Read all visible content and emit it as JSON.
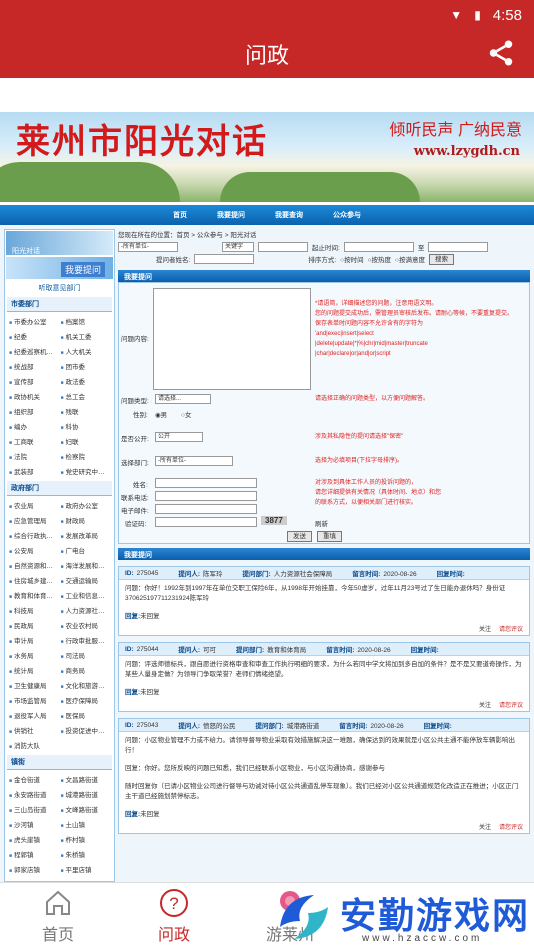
{
  "status": {
    "time": "4:58"
  },
  "appbar": {
    "title": "问政"
  },
  "banner": {
    "title": "莱州市阳光对话",
    "slogan": "倾听民声 广纳民意",
    "url": "www.lzygdh.cn"
  },
  "topnav": [
    "首页",
    "我要提问",
    "我要查询",
    "公众参与"
  ],
  "left": {
    "tile1": "阳光对话",
    "tile2": "我要提问",
    "header": "听取意见部门",
    "sec1": "市委部门",
    "g1": [
      "市委办公室",
      "档案馆",
      "纪委",
      "机关工委",
      "纪委巡察机…",
      "人大机关",
      "统战部",
      "团市委",
      "宣传部",
      "政法委",
      "政协机关",
      "总工会",
      "组织部",
      "残联",
      "编办",
      "科协",
      "工商联",
      "妇联",
      "法院",
      "检察院",
      "武装部",
      "党史研究中…"
    ],
    "sec2": "政府部门",
    "g2": [
      "农业局",
      "政府办公室",
      "应急管理局",
      "财政局",
      "综合行政执…",
      "发展改革局",
      "公安局",
      "广电台",
      "自然资源和…",
      "海洋发展和…",
      "住房城乡建…",
      "交通运输局",
      "教育和体育…",
      "工业和信息…",
      "科技局",
      "人力资源社…",
      "民政局",
      "农业农村局",
      "审计局",
      "行政审批服…",
      "水务局",
      "司法局",
      "统计局",
      "商务局",
      "卫生健康局",
      "文化和旅游…",
      "市场监管局",
      "医疗保障局",
      "退役军人局",
      "医保局",
      "供销社",
      "投资促进中…",
      "消防大队"
    ],
    "sec3": "镇街",
    "g3": [
      "金仓街道",
      "文昌路街道",
      "永安路街道",
      "城港路街道",
      "三山岛街道",
      "文峰路街道",
      "沙河镇",
      "土山镇",
      "虎头崖镇",
      "柞村镇",
      "程郭镇",
      "朱桥镇",
      "郭家店镇",
      "平里店镇"
    ]
  },
  "main": {
    "path": "您现在所在的位置：首页 > 公众参与 > 阳光对话",
    "filter": {
      "dept": "-所有单位-",
      "kw": "关键字",
      "time_label": "起止时间:",
      "to": "至",
      "asker": "提问者姓名:",
      "sort_label": "排序方式:",
      "opt1": "按时间",
      "opt2": "按热度",
      "opt3": "按满意度",
      "search": "搜索"
    },
    "askhead": "我要提问",
    "form": {
      "content_label": "问题内容:",
      "note1": "*请语简，详细描述您的问题，注意用语文明。",
      "note2": "您的问题提交成功后，需管理员审核后发布。请耐心等候，不要重复提交。",
      "note3": "保存表单时问题内容不允许含有的字符为",
      "note4": "'and|exec|insert|select",
      "note5": "|delete|update|*|%|chr|mid|master|truncate",
      "note6": "|char|declare|or|and|or|script",
      "type_label": "问题类型:",
      "type_val": "请选择...",
      "type_note": "请选择正确的问题类型，以方便问题解答。",
      "sex_label": "性别:",
      "male": "男",
      "female": "女",
      "public_label": "是否公开:",
      "public_val": "公开",
      "public_note": "涉及其私隐性的提问请选择\"保密\"",
      "dept_label": "选择部门:",
      "dept_val": "-所有单位-",
      "dept_note": "选择为必填项目(下拉字母排序)。",
      "name_label": "姓名:",
      "phone_label": "联系电话:",
      "email_label": "电子邮件:",
      "code_label": "验证码:",
      "code_val": "3877",
      "refresh": "刷新",
      "info_note1": "对涉及到具体工作人员的投诉问题的，",
      "info_note2": "请您详细提供有关情况（具体时间、地点）和您",
      "info_note3": "的联系方式，以便相关部门进行核实。",
      "submit": "发送",
      "reset": "重填"
    },
    "listhead": "我要提问",
    "cards": [
      {
        "id": "275045",
        "user": "陈军玲",
        "dept": "人力资源社会保障局",
        "time": "2020-08-26",
        "reply_time": "2020-08-26",
        "body": "问题：你好！1992年到1997年在单位交职工保险6年，从1998年开始挂靠，今年50虚岁，过年11月23号过了生日能办退休吗？身份证370625197711231924陈军玲",
        "reply": "未回复",
        "foot": "关注"
      },
      {
        "id": "275044",
        "user": "可可",
        "dept": "教育和体育局",
        "time": "2020-08-26",
        "reply_time": "2020-08-26",
        "body": "问题：评选师德标兵，跟自愿进行资格审查和审查工作执行明细的要求，为什么若同中学文将加到多自加的条件？是不是又要道奇操作，为某些人量身定做？为领导门争取荣誉？老师们情绪绝望。",
        "reply": "未回复",
        "foot": "关注"
      },
      {
        "id": "275043",
        "user": "愤怒的公民",
        "dept": "城港路街道",
        "time": "2020-08-26",
        "reply_time": "2020-08-26",
        "body": "问题：小区物业管理不力或不给力。请领导督导物业采取有效措施解决这一难题，确保达到的效果就是小区公共主通不能停放车辆影响出行！",
        "reply_extra": "回复：你好。您所反映的问题已知悉，我们已经联系小区物业，与小区沟通协商，感谢参与",
        "body2": "随时回复你（已请小区物业公司进行督导与劝诫对待小区公共通道乱停车现象）。我们已经对小区公共通道规范化改造正在推进；小区正门主干道已经施划禁停标志。",
        "reply": "未回复",
        "foot": "关注"
      }
    ],
    "card_labels": {
      "id": "ID:",
      "user": "提问人:",
      "dept": "提问部门:",
      "time": "留言时间:",
      "reply_time": "回复时间:",
      "reply": "回复:",
      "rate": "请您评议"
    }
  },
  "bottomnav": [
    {
      "label": "首页"
    },
    {
      "label": "问政"
    },
    {
      "label": "游莱州"
    }
  ],
  "watermark": {
    "text": "安勤游戏网",
    "url": "www.hzaccw.com"
  }
}
